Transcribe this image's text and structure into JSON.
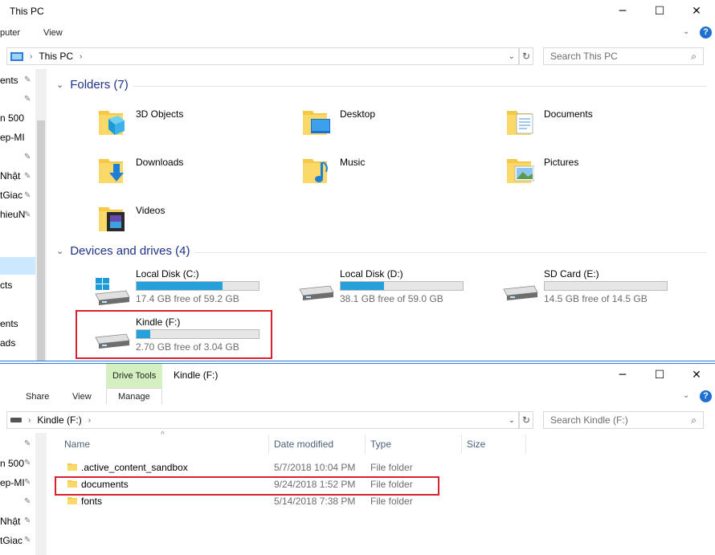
{
  "win1": {
    "title": "This PC",
    "ribbon_tabs": [
      "puter",
      "View"
    ],
    "address": "This PC",
    "search_placeholder": "Search This PC",
    "nav_items": [
      "ents",
      "n 500",
      "ep-MI",
      "Nhật",
      "tGiac",
      "hieuN",
      "cts",
      "ents",
      "ads"
    ],
    "folders_header": "Folders (7)",
    "folders": [
      "3D Objects",
      "Desktop",
      "Documents",
      "Downloads",
      "Music",
      "Pictures",
      "Videos"
    ],
    "drives_header": "Devices and drives (4)",
    "drives": [
      {
        "name": "Local Disk (C:)",
        "free": "17.4 GB free of 59.2 GB",
        "used_fraction": 0.706
      },
      {
        "name": "Local Disk (D:)",
        "free": "38.1 GB free of 59.0 GB",
        "used_fraction": 0.354
      },
      {
        "name": "SD Card (E:)",
        "free": "14.5 GB free of 14.5 GB",
        "used_fraction": 0.0
      },
      {
        "name": "Kindle (F:)",
        "free": "2.70 GB free of 3.04 GB",
        "used_fraction": 0.112
      }
    ]
  },
  "win2": {
    "title": "Kindle (F:)",
    "context_tab": "Drive Tools",
    "ribbon_tabs": [
      "Share",
      "View",
      "Manage"
    ],
    "address": "Kindle (F:)",
    "search_placeholder": "Search Kindle (F:)",
    "nav_items": [
      "n 500",
      "ep-MI",
      "Nhật",
      "tGiac"
    ],
    "columns": [
      "Name",
      "Date modified",
      "Type",
      "Size"
    ],
    "files": [
      {
        "name": ".active_content_sandbox",
        "date": "5/7/2018 10:04 PM",
        "type": "File folder"
      },
      {
        "name": "documents",
        "date": "9/24/2018 1:52 PM",
        "type": "File folder"
      },
      {
        "name": "fonts",
        "date": "5/14/2018 7:38 PM",
        "type": "File folder"
      }
    ]
  },
  "colors": {
    "accent": "#2b79d6",
    "highlight": "#d9202f",
    "drive_fill": "#26a0da",
    "header_text": "#1e3287",
    "context_tab_bg": "#d5f0c0"
  }
}
